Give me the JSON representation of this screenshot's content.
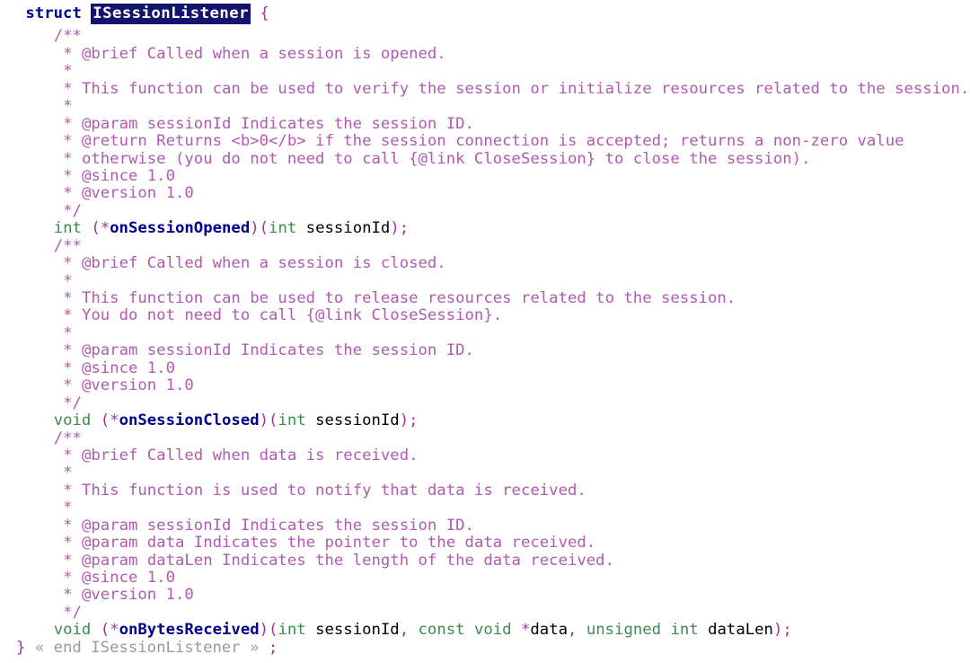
{
  "view": {
    "kind": "source-code-listing",
    "language": "C",
    "background_color": "#ffffff",
    "selection_highlight_bg": "#14146e",
    "selection_highlight_fg": "#ffffff",
    "colors": {
      "keyword": "#00008b",
      "type": "#3c8c4a",
      "punctuation": "#a0359b",
      "identifier": "#000000",
      "function_name": "#00008b",
      "comment": "#b05ab0",
      "fold_marker": "#9a9a9a"
    },
    "selected_symbol": "ISessionListener"
  },
  "lines": [
    {
      "id": "l0",
      "indent": 1,
      "tokens": [
        {
          "t": "struct ",
          "c": "keyword"
        },
        {
          "t": "ISessionListener",
          "c": "selected"
        },
        {
          "t": " ",
          "c": "ident"
        },
        {
          "t": "{",
          "c": "punct"
        }
      ]
    },
    {
      "id": "l1",
      "indent": 4,
      "tokens": [
        {
          "t": "/**",
          "c": "comment"
        }
      ]
    },
    {
      "id": "l2",
      "indent": 5,
      "tokens": [
        {
          "t": "* @brief Called when a session is opened.",
          "c": "comment"
        }
      ]
    },
    {
      "id": "l3",
      "indent": 5,
      "tokens": [
        {
          "t": "*",
          "c": "comment"
        }
      ]
    },
    {
      "id": "l4",
      "indent": 5,
      "tokens": [
        {
          "t": "* This function can be used to verify the session or initialize resources related to the session.",
          "c": "comment"
        }
      ]
    },
    {
      "id": "l5",
      "indent": 5,
      "tokens": [
        {
          "t": "*",
          "c": "comment"
        }
      ]
    },
    {
      "id": "l6",
      "indent": 5,
      "tokens": [
        {
          "t": "* @param sessionId Indicates the session ID.",
          "c": "comment"
        }
      ]
    },
    {
      "id": "l7",
      "indent": 5,
      "tokens": [
        {
          "t": "* @return Returns <b>0</b> if the session connection is accepted; returns a non-zero value",
          "c": "comment"
        }
      ]
    },
    {
      "id": "l8",
      "indent": 5,
      "tokens": [
        {
          "t": "* otherwise (you do not need to call {@link CloseSession} to close the session).",
          "c": "comment"
        }
      ]
    },
    {
      "id": "l9",
      "indent": 5,
      "tokens": [
        {
          "t": "* @since 1.0",
          "c": "comment"
        }
      ]
    },
    {
      "id": "l10",
      "indent": 5,
      "tokens": [
        {
          "t": "* @version 1.0",
          "c": "comment"
        }
      ]
    },
    {
      "id": "l11",
      "indent": 5,
      "tokens": [
        {
          "t": "*/",
          "c": "comment"
        }
      ]
    },
    {
      "id": "l12",
      "indent": 4,
      "tokens": [
        {
          "t": "int",
          "c": "type"
        },
        {
          "t": " ",
          "c": "ident"
        },
        {
          "t": "(*",
          "c": "punct"
        },
        {
          "t": "onSessionOpened",
          "c": "func"
        },
        {
          "t": ")(",
          "c": "punct"
        },
        {
          "t": "int",
          "c": "type"
        },
        {
          "t": " ",
          "c": "ident"
        },
        {
          "t": "sessionId",
          "c": "ident"
        },
        {
          "t": ");",
          "c": "punct"
        }
      ]
    },
    {
      "id": "l13",
      "indent": 4,
      "tokens": [
        {
          "t": "/**",
          "c": "comment"
        }
      ]
    },
    {
      "id": "l14",
      "indent": 5,
      "tokens": [
        {
          "t": "* @brief Called when a session is closed.",
          "c": "comment"
        }
      ]
    },
    {
      "id": "l15",
      "indent": 5,
      "tokens": [
        {
          "t": "*",
          "c": "comment"
        }
      ]
    },
    {
      "id": "l16",
      "indent": 5,
      "tokens": [
        {
          "t": "* This function can be used to release resources related to the session.",
          "c": "comment"
        }
      ]
    },
    {
      "id": "l17",
      "indent": 5,
      "tokens": [
        {
          "t": "* You do not need to call {@link CloseSession}.",
          "c": "comment"
        }
      ]
    },
    {
      "id": "l18",
      "indent": 5,
      "tokens": [
        {
          "t": "*",
          "c": "comment"
        }
      ]
    },
    {
      "id": "l19",
      "indent": 5,
      "tokens": [
        {
          "t": "* @param sessionId Indicates the session ID.",
          "c": "comment"
        }
      ]
    },
    {
      "id": "l20",
      "indent": 5,
      "tokens": [
        {
          "t": "* @since 1.0",
          "c": "comment"
        }
      ]
    },
    {
      "id": "l21",
      "indent": 5,
      "tokens": [
        {
          "t": "* @version 1.0",
          "c": "comment"
        }
      ]
    },
    {
      "id": "l22",
      "indent": 5,
      "tokens": [
        {
          "t": "*/",
          "c": "comment"
        }
      ]
    },
    {
      "id": "l23",
      "indent": 4,
      "tokens": [
        {
          "t": "void",
          "c": "type"
        },
        {
          "t": " ",
          "c": "ident"
        },
        {
          "t": "(*",
          "c": "punct"
        },
        {
          "t": "onSessionClosed",
          "c": "func"
        },
        {
          "t": ")(",
          "c": "punct"
        },
        {
          "t": "int",
          "c": "type"
        },
        {
          "t": " ",
          "c": "ident"
        },
        {
          "t": "sessionId",
          "c": "ident"
        },
        {
          "t": ");",
          "c": "punct"
        }
      ]
    },
    {
      "id": "l24",
      "indent": 4,
      "tokens": [
        {
          "t": "/**",
          "c": "comment"
        }
      ]
    },
    {
      "id": "l25",
      "indent": 5,
      "tokens": [
        {
          "t": "* @brief Called when data is received.",
          "c": "comment"
        }
      ]
    },
    {
      "id": "l26",
      "indent": 5,
      "tokens": [
        {
          "t": "*",
          "c": "comment"
        }
      ]
    },
    {
      "id": "l27",
      "indent": 5,
      "tokens": [
        {
          "t": "* This function is used to notify that data is received.",
          "c": "comment"
        }
      ]
    },
    {
      "id": "l28",
      "indent": 5,
      "tokens": [
        {
          "t": "*",
          "c": "comment"
        }
      ]
    },
    {
      "id": "l29",
      "indent": 5,
      "tokens": [
        {
          "t": "* @param sessionId Indicates the session ID.",
          "c": "comment"
        }
      ]
    },
    {
      "id": "l30",
      "indent": 5,
      "tokens": [
        {
          "t": "* @param data Indicates the pointer to the data received.",
          "c": "comment"
        }
      ]
    },
    {
      "id": "l31",
      "indent": 5,
      "tokens": [
        {
          "t": "* @param dataLen Indicates the length of the data received.",
          "c": "comment"
        }
      ]
    },
    {
      "id": "l32",
      "indent": 5,
      "tokens": [
        {
          "t": "* @since 1.0",
          "c": "comment"
        }
      ]
    },
    {
      "id": "l33",
      "indent": 5,
      "tokens": [
        {
          "t": "* @version 1.0",
          "c": "comment"
        }
      ]
    },
    {
      "id": "l34",
      "indent": 5,
      "tokens": [
        {
          "t": "*/",
          "c": "comment"
        }
      ]
    },
    {
      "id": "l35",
      "indent": 4,
      "tokens": [
        {
          "t": "void",
          "c": "type"
        },
        {
          "t": " ",
          "c": "ident"
        },
        {
          "t": "(*",
          "c": "punct"
        },
        {
          "t": "onBytesReceived",
          "c": "func"
        },
        {
          "t": ")(",
          "c": "punct"
        },
        {
          "t": "int",
          "c": "type"
        },
        {
          "t": " ",
          "c": "ident"
        },
        {
          "t": "sessionId",
          "c": "ident"
        },
        {
          "t": ", ",
          "c": "punct"
        },
        {
          "t": "const",
          "c": "type"
        },
        {
          "t": " ",
          "c": "ident"
        },
        {
          "t": "void",
          "c": "type"
        },
        {
          "t": " ",
          "c": "ident"
        },
        {
          "t": "*",
          "c": "punct"
        },
        {
          "t": "data",
          "c": "ident"
        },
        {
          "t": ", ",
          "c": "punct"
        },
        {
          "t": "unsigned",
          "c": "type"
        },
        {
          "t": " ",
          "c": "ident"
        },
        {
          "t": "int",
          "c": "type"
        },
        {
          "t": " ",
          "c": "ident"
        },
        {
          "t": "dataLen",
          "c": "ident"
        },
        {
          "t": ");",
          "c": "punct"
        }
      ]
    },
    {
      "id": "l36",
      "indent": 0,
      "tokens": [
        {
          "t": "}",
          "c": "punct"
        },
        {
          "t": " ",
          "c": "ident"
        },
        {
          "t": "« end ISessionListener »",
          "c": "fold"
        },
        {
          "t": " ",
          "c": "ident"
        },
        {
          "t": ";",
          "c": "punct"
        }
      ]
    }
  ]
}
